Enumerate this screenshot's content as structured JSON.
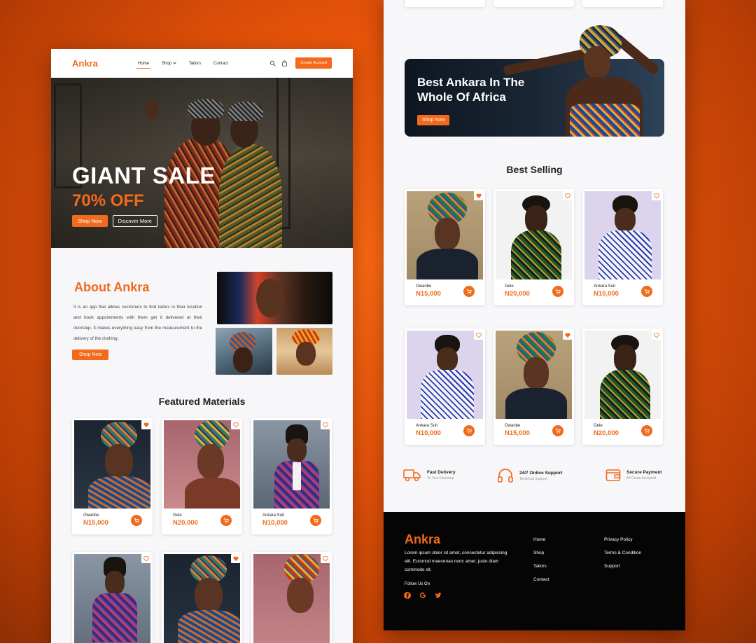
{
  "left": {
    "nav": {
      "logo": "Ankra",
      "links": [
        "Home",
        "Shop",
        "Tailors",
        "Contact"
      ],
      "cta": "Create Account"
    },
    "hero": {
      "title": "GIANT SALE",
      "subtitle": "70% OFF",
      "primary_btn": "Shop Now",
      "secondary_btn": "Discover More"
    },
    "about": {
      "title": "About Ankra",
      "text": "It is an app that allows customers to find tailors in their location and book appointments with them get it delivered at their doorstep. It makes everything easy from the measurement to the delivery of the clothing.",
      "btn": "Shop Now"
    },
    "featured": {
      "title": "Featured Materials",
      "products": [
        {
          "name": "Owanbe",
          "price": "N15,000"
        },
        {
          "name": "Gele",
          "price": "N20,000"
        },
        {
          "name": "Ankara Suit",
          "price": "N10,000"
        }
      ]
    }
  },
  "right": {
    "banner": {
      "title": "Best Ankara In The Whole Of Africa",
      "btn": "Shop Now"
    },
    "best_selling": {
      "title": "Best Selling",
      "row1": [
        {
          "name": "Owanbe",
          "price": "N15,000"
        },
        {
          "name": "Gele",
          "price": "N20,000"
        },
        {
          "name": "Ankara Suit",
          "price": "N10,000"
        }
      ],
      "row2": [
        {
          "name": "Ankara Suit",
          "price": "N10,000"
        },
        {
          "name": "Owanbe",
          "price": "N15,000"
        },
        {
          "name": "Gele",
          "price": "N20,000"
        }
      ]
    },
    "features": [
      {
        "title": "Fast Delivery",
        "sub": "To Your Doorstep",
        "icon": "truck-icon"
      },
      {
        "title": "24/7 Online Support",
        "sub": "Technical Support",
        "icon": "headphones-icon"
      },
      {
        "title": "Secure Payment",
        "sub": "All Cards Accepted",
        "icon": "wallet-icon"
      }
    ],
    "footer": {
      "logo": "Ankra",
      "text": "Lorem ipsum dolor sit amet, consectetur adipiscing elit. Euismod maecenas nunc amet, justo diam commodo sit.",
      "follow": "Follow Us On",
      "col1": [
        "Home",
        "Shop",
        "Tailors",
        "Contact"
      ],
      "col2": [
        "Privacy Policy",
        "Terms & Condition",
        "Support"
      ]
    }
  },
  "colors": {
    "accent": "#f26a1b",
    "background": "#e8540a",
    "footer": "#050505"
  }
}
